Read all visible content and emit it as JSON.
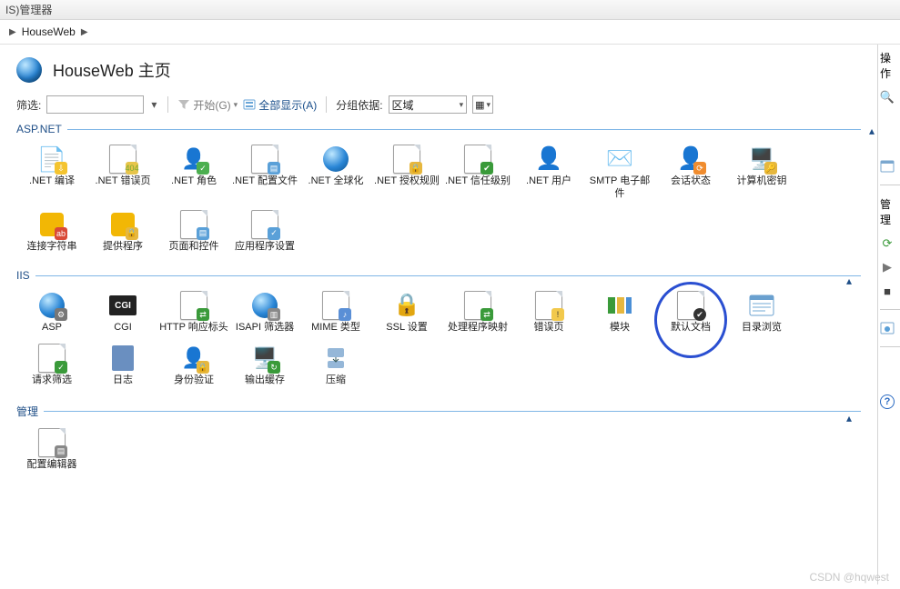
{
  "title_bar": "IS)管理器",
  "breadcrumb": {
    "item1": "HouseWeb"
  },
  "page_title": "HouseWeb 主页",
  "filter": {
    "label": "筛选:",
    "start": "开始(G)",
    "show_all": "全部显示(A)",
    "group_by_label": "分组依据:",
    "group_by_value": "区域"
  },
  "sections": {
    "aspnet": {
      "title": "ASP.NET",
      "items": [
        ".NET 编译",
        ".NET 错误页",
        ".NET 角色",
        ".NET 配置文件",
        ".NET 全球化",
        ".NET 授权规则",
        ".NET 信任级别",
        ".NET 用户",
        "SMTP 电子邮件",
        "会话状态",
        "计算机密钥",
        "连接字符串",
        "提供程序",
        "页面和控件",
        "应用程序设置"
      ]
    },
    "iis": {
      "title": "IIS",
      "items": [
        "ASP",
        "CGI",
        "HTTP 响应标头",
        "ISAPI 筛选器",
        "MIME 类型",
        "SSL 设置",
        "处理程序映射",
        "错误页",
        "模块",
        "默认文档",
        "目录浏览",
        "请求筛选",
        "日志",
        "身份验证",
        "输出缓存",
        "压缩"
      ],
      "highlight_index": 9
    },
    "manage": {
      "title": "管理",
      "items": [
        "配置编辑器"
      ]
    }
  },
  "right_pane": {
    "header1": "操作",
    "header2": "管理"
  },
  "watermark": "CSDN @hqwest"
}
